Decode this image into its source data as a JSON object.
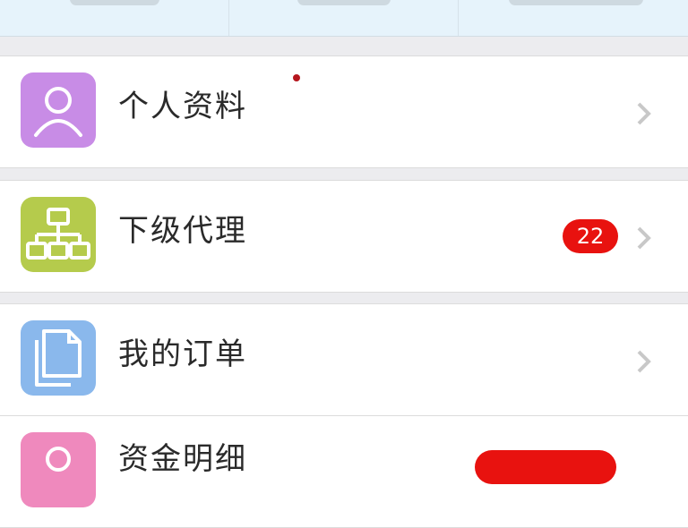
{
  "colors": {
    "profile_icon_bg": "#c88ce6",
    "agent_icon_bg": "#b5cb4c",
    "orders_icon_bg": "#8ab8ec",
    "wallet_icon_bg": "#ef89bd",
    "badge_red": "#e8120f",
    "dot_red": "#b5161d",
    "chevron": "#c8c8c8"
  },
  "menu": {
    "items": [
      {
        "label": "个人资料",
        "icon": "person-icon",
        "has_dot": true
      },
      {
        "label": "下级代理",
        "icon": "hierarchy-icon",
        "badge": "22"
      },
      {
        "label": "我的订单",
        "icon": "documents-icon"
      },
      {
        "label": "资金明细",
        "icon": "wallet-icon"
      }
    ]
  }
}
